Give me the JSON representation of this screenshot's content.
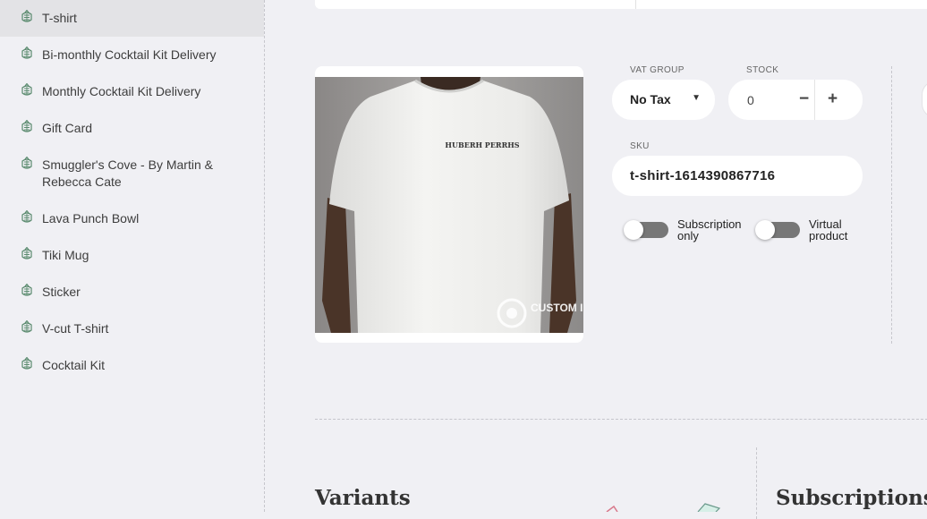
{
  "sidebar": {
    "items": [
      {
        "label": "T-shirt",
        "icon": "pineapple-icon"
      },
      {
        "label": "Bi-monthly Cocktail Kit Delivery",
        "icon": "pineapple-icon"
      },
      {
        "label": "Monthly Cocktail Kit Delivery",
        "icon": "pineapple-icon"
      },
      {
        "label": "Gift Card",
        "icon": "pineapple-icon"
      },
      {
        "label": "Smuggler's Cove - By Martin & Rebecca Cate",
        "icon": "pineapple-icon"
      },
      {
        "label": "Lava Punch Bowl",
        "icon": "pineapple-icon"
      },
      {
        "label": "Tiki Mug",
        "icon": "pineapple-icon"
      },
      {
        "label": "Sticker",
        "icon": "pineapple-icon"
      },
      {
        "label": "V-cut T-shirt",
        "icon": "pineapple-icon"
      },
      {
        "label": "Cocktail Kit",
        "icon": "pineapple-icon"
      }
    ],
    "active_index": 0
  },
  "product": {
    "image_print_text": "HUBERH PERRHS",
    "image_watermark": "CUSTOM INK",
    "vat_group": {
      "label": "VAT GROUP",
      "value": "No Tax",
      "caret": "▼"
    },
    "stock": {
      "label": "STOCK",
      "value": "0",
      "minus": "−",
      "plus": "+"
    },
    "sku": {
      "label": "SKU",
      "value": "t-shirt-1614390867716"
    },
    "toggles": [
      {
        "label": "Subscription only",
        "on": false
      },
      {
        "label": "Virtual product",
        "on": false
      }
    ]
  },
  "sections": {
    "variants_title": "Variants",
    "subscriptions_title": "Subscriptions"
  },
  "colors": {
    "background": "#f0f0f4",
    "sidebar_active": "#e3e3e6",
    "icon_green": "#5a8a6e",
    "toggle_off": "#777777"
  }
}
